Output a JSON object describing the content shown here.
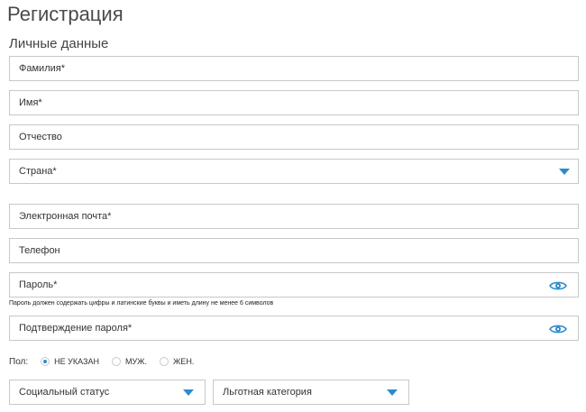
{
  "page": {
    "title": "Регистрация",
    "section_title": "Личные данные"
  },
  "fields": {
    "last_name": "Фамилия*",
    "first_name": "Имя*",
    "patronymic": "Отчество",
    "country": "Страна*",
    "email": "Электронная почта*",
    "phone": "Телефон",
    "password": "Пароль*",
    "password_hint": "Пароль должен содержать цифры и латинские буквы и иметь длину не менее 6 символов",
    "password_confirm": "Подтверждение пароля*"
  },
  "gender": {
    "label": "Пол:",
    "options": [
      "НЕ УКАЗАН",
      "МУЖ.",
      "ЖЕН."
    ],
    "selected": "НЕ УКАЗАН"
  },
  "selects": {
    "social_status": "Социальный статус",
    "benefit_category": "Льготная категория"
  },
  "colors": {
    "accent": "#2d8ccb",
    "border": "#c8c8c8"
  },
  "icons": {
    "select_arrow": "triangle-down-icon",
    "password_toggle": "eye-icon"
  }
}
